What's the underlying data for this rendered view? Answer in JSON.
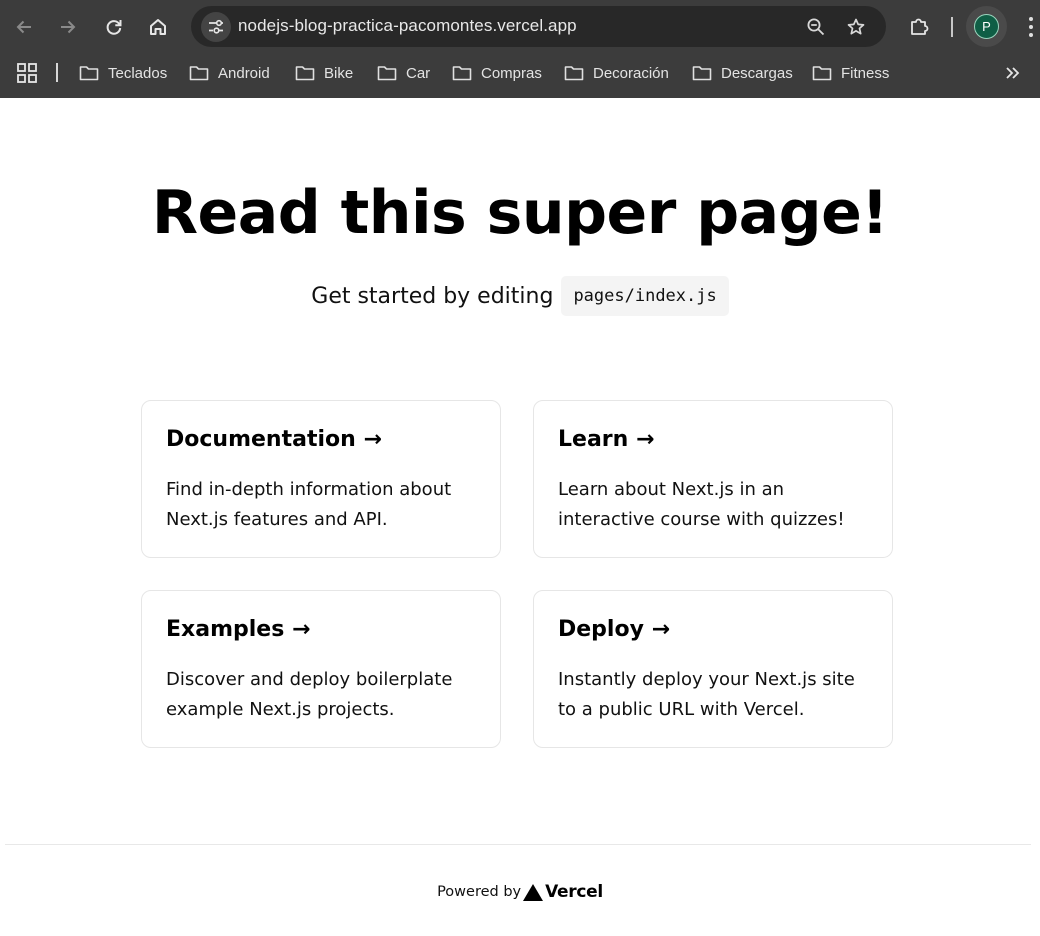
{
  "browser": {
    "url": "nodejs-blog-practica-pacomontes.vercel.app",
    "profile_initial": "P",
    "accent_color": "#0f5e45",
    "icons": {
      "back": "arrow-left-icon",
      "forward": "arrow-right-icon",
      "reload": "reload-icon",
      "home": "home-icon",
      "site_info": "tune-icon",
      "zoom": "zoom-out-icon",
      "bookmark": "star-icon",
      "extensions": "puzzle-icon",
      "menu": "more-vert-icon"
    },
    "bookmarks": [
      {
        "label": "Teclados"
      },
      {
        "label": "Android"
      },
      {
        "label": "Bike"
      },
      {
        "label": "Car"
      },
      {
        "label": "Compras"
      },
      {
        "label": "Decoración"
      },
      {
        "label": "Descargas"
      },
      {
        "label": "Fitness"
      }
    ]
  },
  "page": {
    "title": "Read this super page!",
    "subtitle": "Get started by editing",
    "code": "pages/index.js",
    "cards": [
      {
        "title": "Documentation →",
        "description": "Find in-depth information about Next.js features and API."
      },
      {
        "title": "Learn →",
        "description": "Learn about Next.js in an interactive course with quizzes!"
      },
      {
        "title": "Examples →",
        "description": "Discover and deploy boilerplate example Next.js projects."
      },
      {
        "title": "Deploy →",
        "description": "Instantly deploy your Next.js site to a public URL with Vercel."
      }
    ],
    "footer": {
      "powered_by": "Powered by",
      "brand": "Vercel"
    }
  }
}
